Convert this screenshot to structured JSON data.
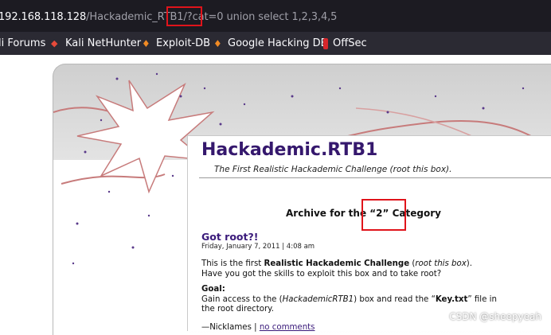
{
  "browser": {
    "url": {
      "host": "192.168.118.128",
      "path": "/Hackademic_RTB1/",
      "param": "?cat=0",
      "query": " union select 1,2,3,4,5"
    },
    "bookmarks": [
      {
        "label": "li Forums",
        "icon": "kali-forums-icon"
      },
      {
        "label": "Kali NetHunter",
        "icon": "kali-nethunter-icon"
      },
      {
        "label": "Exploit-DB",
        "icon": "exploit-db-icon"
      },
      {
        "label": "Google Hacking DB",
        "icon": "ghdb-icon"
      },
      {
        "label": "OffSec",
        "icon": "offsec-icon"
      }
    ],
    "highlight_color": "#e0141b"
  },
  "site": {
    "title": "Hackademic.RTB1",
    "subtitle": "The First Realistic Hackademic Challenge (root this box).",
    "title_color": "#35186d"
  },
  "archive": {
    "prefix": "Archive for the ",
    "category": "“2”",
    "suffix": " Category"
  },
  "post": {
    "title": "Got root?!",
    "date": "Friday, January 7, 2011 | 4:08 am",
    "intro_1": "This is the first ",
    "intro_bold": "Realistic Hackademic Challenge",
    "intro_2": " (",
    "intro_italic": "root this box",
    "intro_3": ").",
    "intro_line2": "Have you got the skills to exploit this box and to take root?",
    "goal_heading": "Goal:",
    "goal_1": "Gain access to the (",
    "goal_italic": "HackademicRTB1",
    "goal_2": ") box and read the “",
    "goal_bold": "Key.txt",
    "goal_3": "” file in the root directory.",
    "author": "—NickIames",
    "separator": " | ",
    "comments_link": "no comments"
  },
  "watermark": "CSDN @sheepyeah"
}
